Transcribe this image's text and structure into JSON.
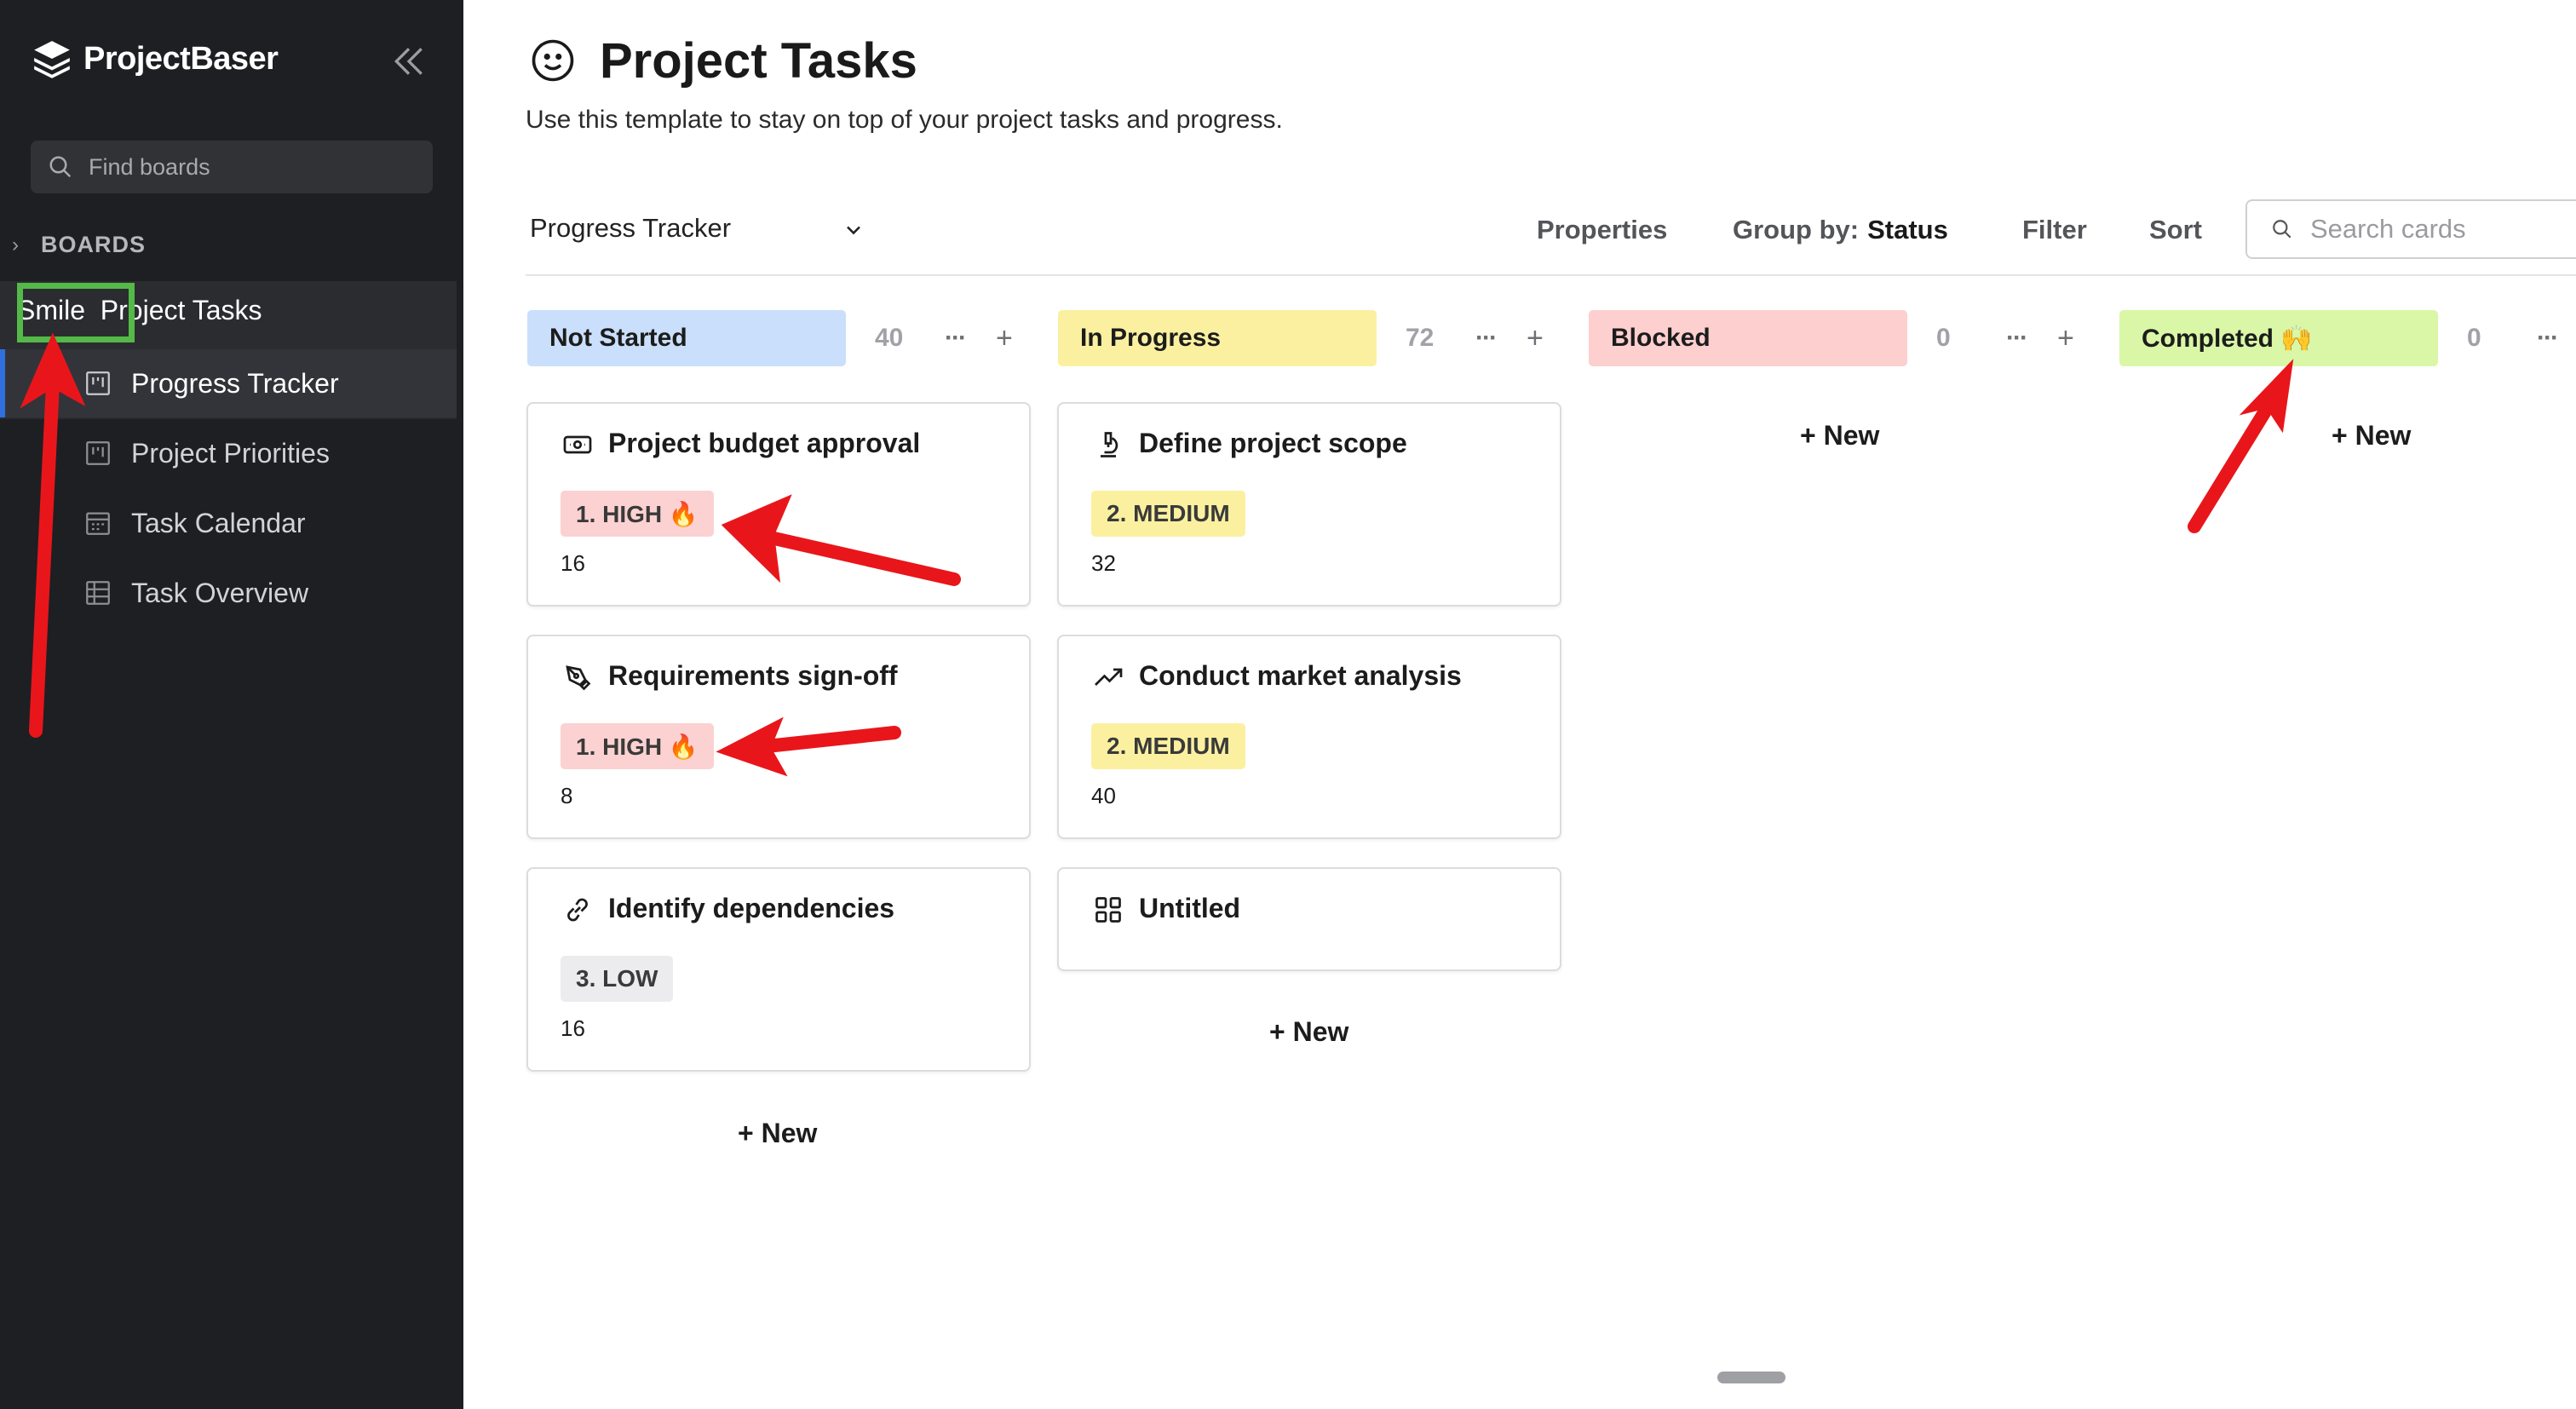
{
  "app": {
    "brand": "ProjectBaser"
  },
  "sidebar": {
    "search_placeholder": "Find boards",
    "section_label": "BOARDS",
    "board": {
      "icon_text": "Smile",
      "title": "Smile  Project Tasks"
    },
    "views": [
      {
        "label": "Progress Tracker",
        "icon": "board-icon",
        "active": true
      },
      {
        "label": "Project Priorities",
        "icon": "board-icon",
        "active": false
      },
      {
        "label": "Task Calendar",
        "icon": "calendar-icon",
        "active": false
      },
      {
        "label": "Task Overview",
        "icon": "table-icon",
        "active": false
      }
    ]
  },
  "page": {
    "title": "Project Tasks",
    "description": "Use this template to stay on top of your project tasks and progress."
  },
  "toolbar": {
    "view_name": "Progress Tracker",
    "properties": "Properties",
    "group_by_label": "Group by:",
    "group_by_value": "Status",
    "filter": "Filter",
    "sort": "Sort",
    "search_placeholder": "Search cards"
  },
  "columns": [
    {
      "name": "Not Started",
      "count": "40",
      "color": "#c9dffb",
      "cards": [
        {
          "title": "Project budget approval",
          "icon": "money-icon",
          "tag": "1. HIGH 🔥",
          "priority": "high",
          "value": "16"
        },
        {
          "title": "Requirements sign-off",
          "icon": "pen-icon",
          "tag": "1. HIGH 🔥",
          "priority": "high",
          "value": "8"
        },
        {
          "title": "Identify dependencies",
          "icon": "link-icon",
          "tag": "3. LOW",
          "priority": "low",
          "value": "16"
        }
      ],
      "new_label": "+ New"
    },
    {
      "name": "In Progress",
      "count": "72",
      "color": "#fbf0a0",
      "cards": [
        {
          "title": "Define project scope",
          "icon": "microscope-icon",
          "tag": "2. MEDIUM",
          "priority": "medium",
          "value": "32"
        },
        {
          "title": "Conduct market analysis",
          "icon": "trend-icon",
          "tag": "2. MEDIUM",
          "priority": "medium",
          "value": "40"
        },
        {
          "title": "Untitled",
          "icon": "grid-icon"
        }
      ],
      "new_label": "+ New"
    },
    {
      "name": "Blocked",
      "count": "0",
      "color": "#fdcfcf",
      "cards": [],
      "new_label": "+ New"
    },
    {
      "name": "Completed 🙌",
      "count": "0",
      "color": "#d9f7a6",
      "cards": [],
      "new_label": "+ New"
    }
  ],
  "colors": {
    "annotation_red": "#e8161b",
    "annotation_green": "#54b948",
    "sidebar_bg": "#1e1f22",
    "accent": "#2f6fe0"
  }
}
